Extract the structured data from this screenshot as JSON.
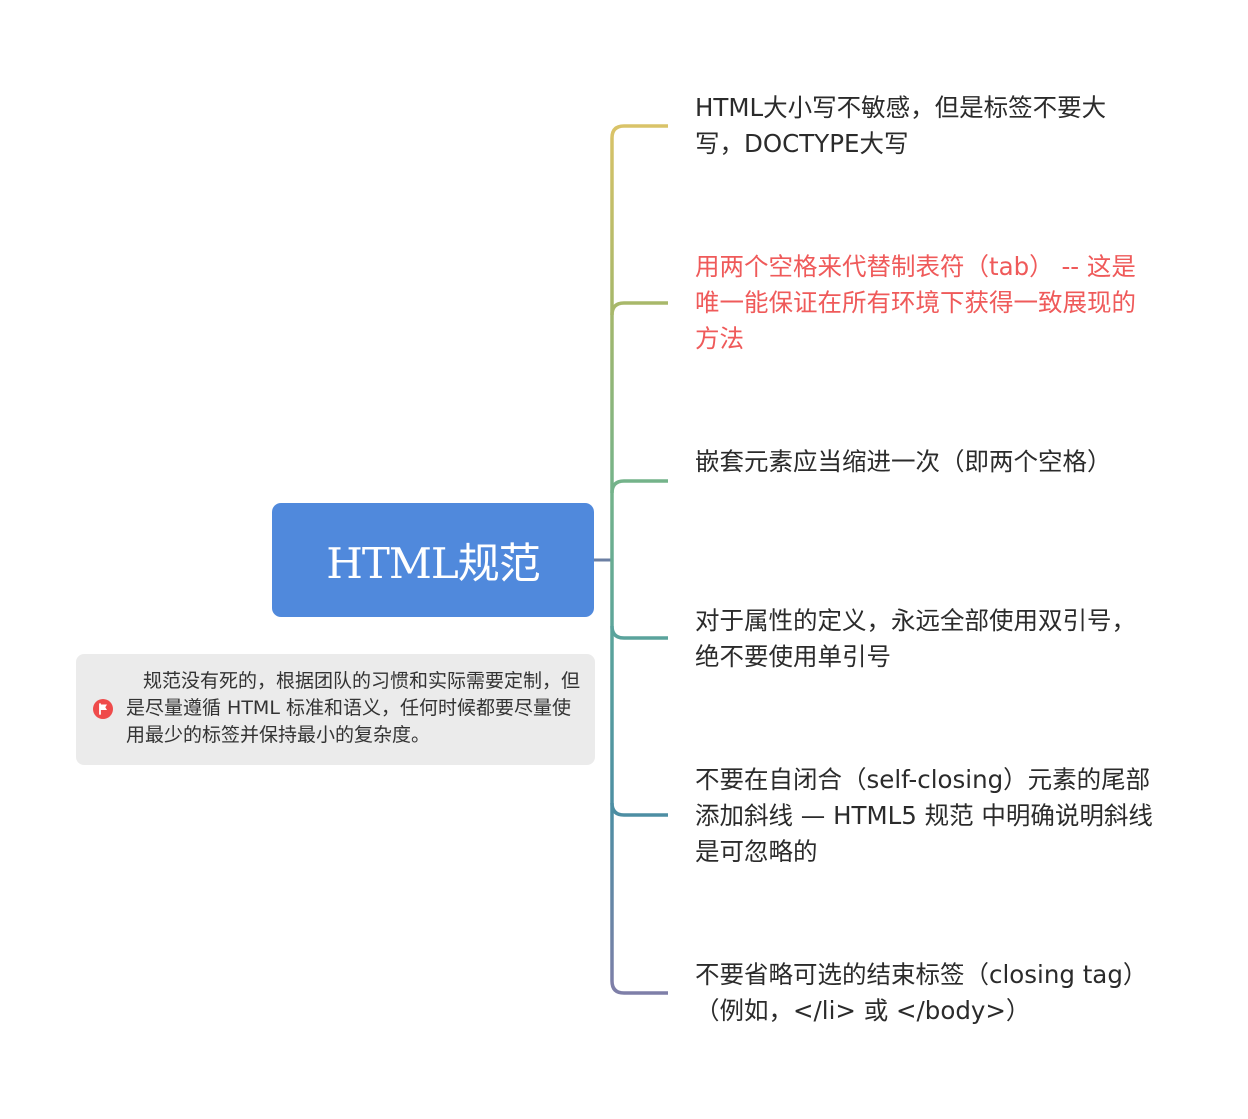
{
  "root": {
    "title": "HTML规范",
    "color": "#5089dc"
  },
  "note": {
    "icon": "flag-icon",
    "text": "规范没有死的，根据团队的习惯和实际需要定制，但是尽量遵循 HTML 标准和语义，任何时候都要尽量使用最少的标签并保持最小的复杂度。"
  },
  "branches": [
    {
      "text": "HTML大小写不敏感，但是标签不要大写，DOCTYPE大写",
      "color": "#d9c368"
    },
    {
      "text": "用两个空格来代替制表符（tab） -- 这是唯一能保证在所有环境下获得一致展现的方法",
      "color": "#a8b86a",
      "text_color": "#ef5a5a"
    },
    {
      "text": "嵌套元素应当缩进一次（即两个空格）",
      "color": "#74b38a"
    },
    {
      "text": "对于属性的定义，永远全部使用双引号，绝不要使用单引号",
      "color": "#5aa39c"
    },
    {
      "text": "不要在自闭合（self-closing）元素的尾部添加斜线 — HTML5 规范 中明确说明斜线是可忽略的",
      "color": "#4d8ea3"
    },
    {
      "text": "不要省略可选的结束标签（closing tag）（例如，</li> 或 </body>）",
      "color": "#7e7fa8"
    }
  ]
}
